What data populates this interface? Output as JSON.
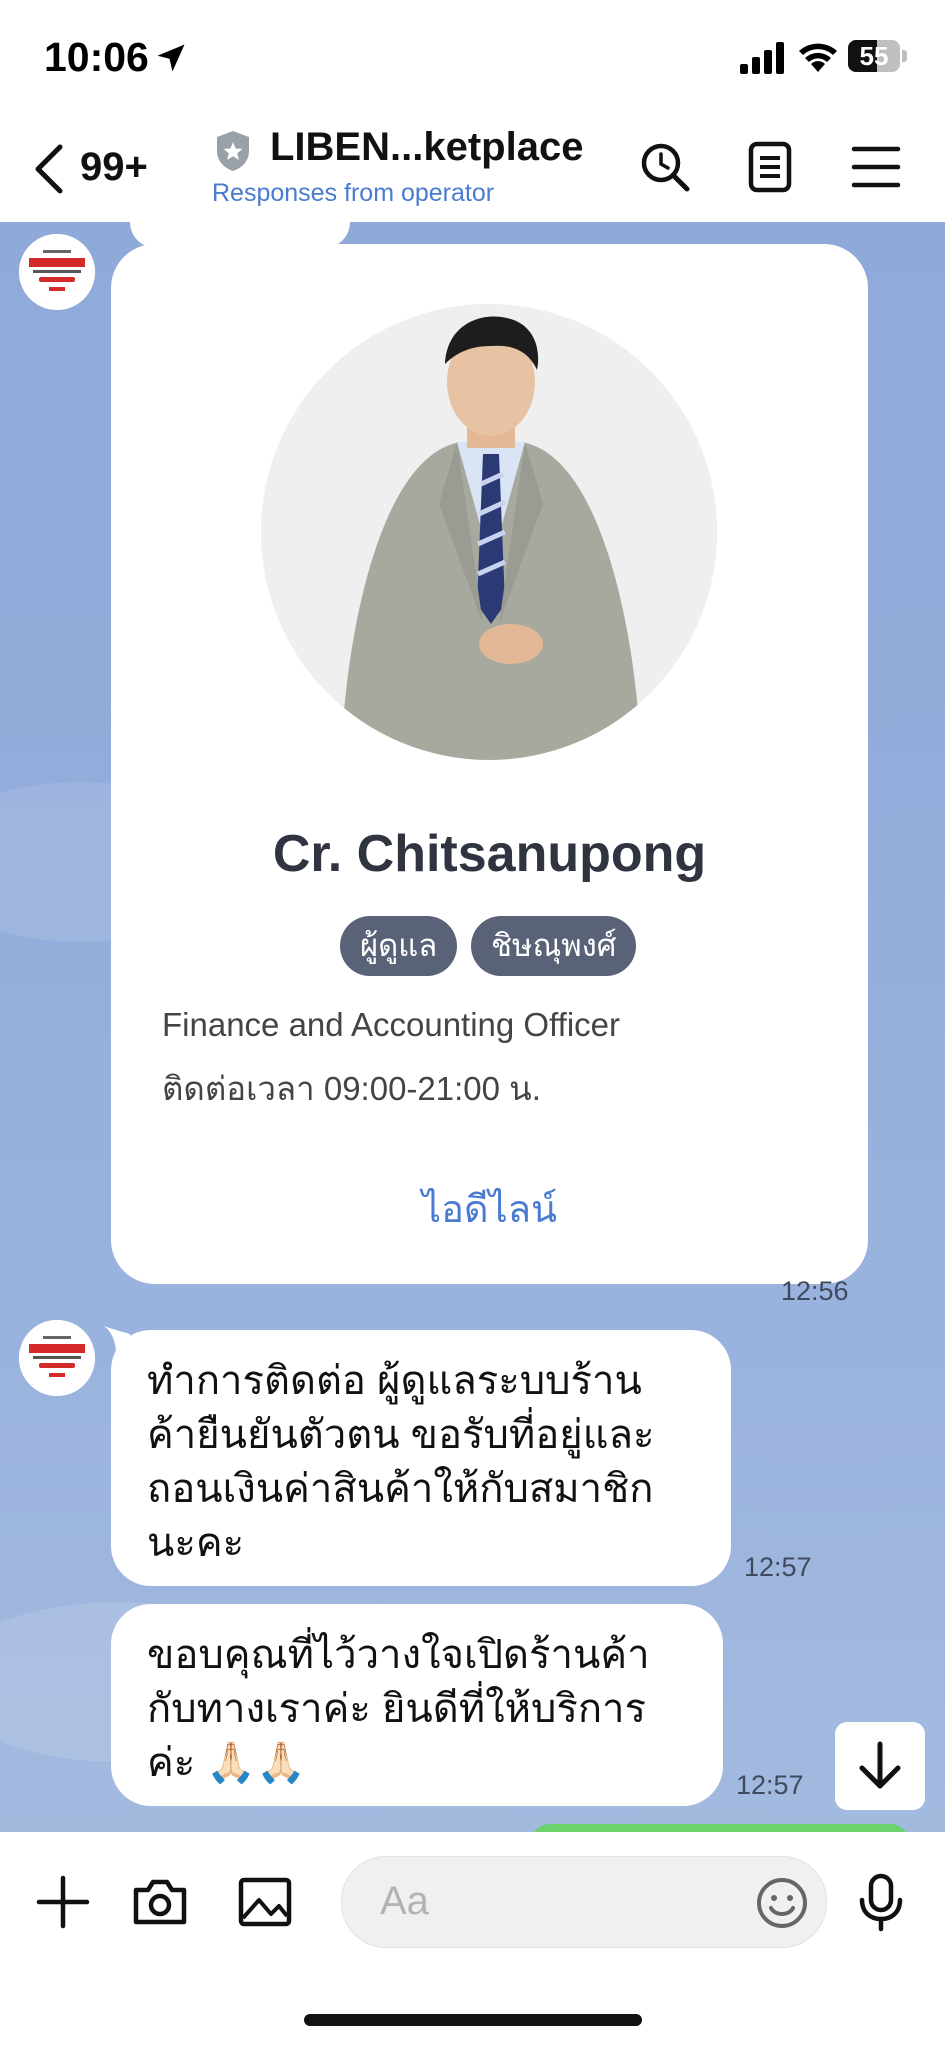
{
  "status_bar": {
    "time": "10:06",
    "battery": "55",
    "battery_level": 0.55
  },
  "header": {
    "unread_count": "99+",
    "title": "LIBEN...ketplace",
    "subtitle": "Responses from operator"
  },
  "messages": {
    "profile_card": {
      "name": "Cr. Chitsanupong",
      "tags": [
        "ผู้ดูแล",
        "ชิษณุพงศ์"
      ],
      "role": "Finance and Accounting Officer",
      "hours": "ติดต่อเวลา 09:00-21:00 น.",
      "link": "ไอดีไลน์",
      "time": "12:56"
    },
    "msg1": {
      "lines": [
        "ทำการติดต่อ ผู้ดูแลระบบร้าน",
        "ค้ายืนยันตัวตน ขอรับที่อยู่และ",
        "ถอนเงินค่าสินค้าให้กับสมาชิก",
        "นะคะ"
      ],
      "time": "12:57"
    },
    "msg2": {
      "lines": [
        "ขอบคุณที่ไว้วางใจเปิดร้านค้า",
        "กับทางเราค่ะ ยินดีที่ให้บริการ",
        "ค่ะ 🙏🏻🙏🏻"
      ],
      "time": "12:57"
    }
  },
  "input": {
    "placeholder": "Aa"
  },
  "icons": {
    "header": [
      "back-icon",
      "shield-icon",
      "search-icon",
      "notes-icon",
      "menu-icon"
    ],
    "input_bar": [
      "plus-icon",
      "camera-icon",
      "image-icon",
      "emoji-icon",
      "microphone-icon"
    ]
  },
  "colors": {
    "chat_background": "#93addb",
    "link": "#4a7bd0",
    "tag": "#5a6277",
    "outgoing_bubble": "#6bd36a"
  }
}
